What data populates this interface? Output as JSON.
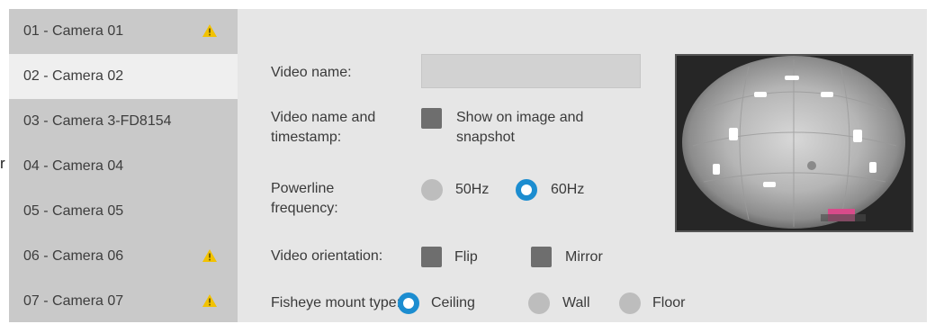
{
  "edge_fragment": "r",
  "sidebar": {
    "items": [
      {
        "label": "01 - Camera 01",
        "warning": true
      },
      {
        "label": "02 - Camera 02",
        "warning": false,
        "selected": true
      },
      {
        "label": "03 - Camera 3-FD8154",
        "warning": false
      },
      {
        "label": "04 - Camera 04",
        "warning": false
      },
      {
        "label": "05 - Camera 05",
        "warning": false
      },
      {
        "label": "06 - Camera 06",
        "warning": true
      },
      {
        "label": "07 - Camera 07",
        "warning": true
      }
    ]
  },
  "settings": {
    "video_name": {
      "label": "Video name:",
      "value": ""
    },
    "name_timestamp": {
      "label": "Video name and timestamp:",
      "option": "Show on image and snapshot",
      "checked": false
    },
    "powerline": {
      "label": "Powerline frequency:",
      "options": [
        "50Hz",
        "60Hz"
      ],
      "selected": "60Hz"
    },
    "orientation": {
      "label": "Video orientation:",
      "flip": "Flip",
      "mirror": "Mirror"
    },
    "mount": {
      "label": "Fisheye mount type:",
      "options": [
        "Ceiling",
        "Wall",
        "Floor"
      ],
      "selected": "Ceiling"
    }
  },
  "colors": {
    "accent": "#1c8dd0",
    "warning": "#f2c200",
    "sidebar_bg": "#c9c9c9",
    "panel_bg": "#e6e6e6"
  }
}
